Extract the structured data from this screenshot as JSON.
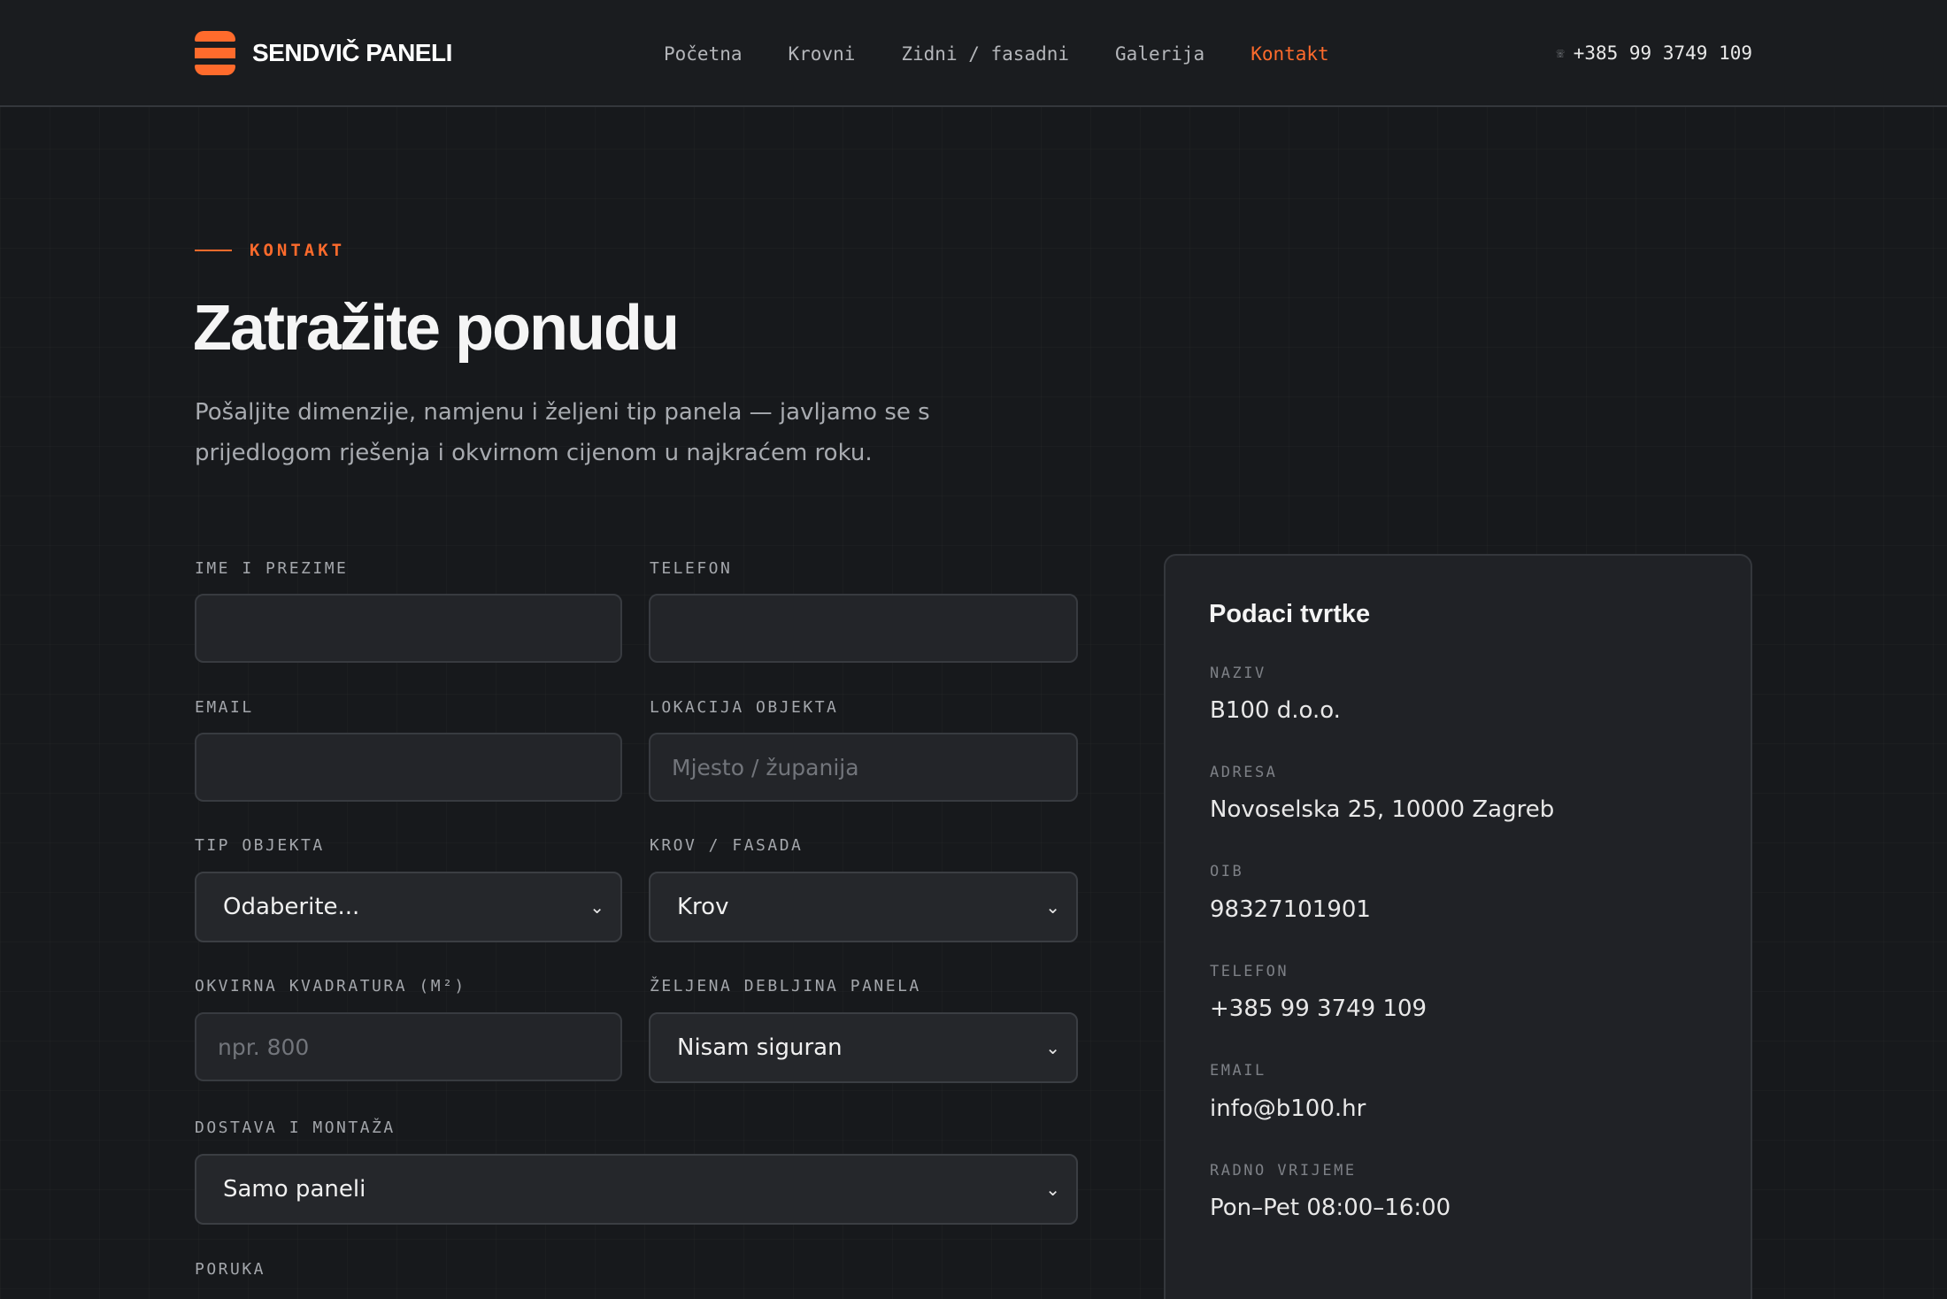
{
  "brand": {
    "name": "SENDVIČ PANELI",
    "accent": "#ff6b2c"
  },
  "nav": {
    "items": [
      {
        "label": "Početna",
        "active": false
      },
      {
        "label": "Krovni",
        "active": false
      },
      {
        "label": "Zidni / fasadni",
        "active": false
      },
      {
        "label": "Galerija",
        "active": false
      },
      {
        "label": "Kontakt",
        "active": true
      }
    ],
    "phone": "+385 99 3749 109",
    "phone_icon": "phone-icon"
  },
  "hero": {
    "eyebrow": "KONTAKT",
    "title": "Zatražite ponudu",
    "lead": "Pošaljite dimenzije, namjenu i željeni tip panela — javljamo se s prijedlogom rješenja i okvirnom cijenom u najkraćem roku."
  },
  "form": {
    "name_label": "IME I PREZIME",
    "name_value": "",
    "phone_label": "TELEFON",
    "phone_value": "",
    "email_label": "EMAIL",
    "email_value": "",
    "location_label": "LOKACIJA OBJEKTA",
    "location_placeholder": "Mjesto / županija",
    "object_type_label": "TIP OBJEKTA",
    "object_type_value": "Odaberite...",
    "roof_facade_label": "KROV / FASADA",
    "roof_facade_value": "Krov",
    "area_label": "OKVIRNA KVADRATURA (M²)",
    "area_placeholder": "npr. 800",
    "thickness_label": "ŽELJENA DEBLJINA PANELA",
    "thickness_value": "Nisam siguran",
    "delivery_label": "DOSTAVA I MONTAŽA",
    "delivery_value": "Samo paneli",
    "message_label": "PORUKA"
  },
  "company": {
    "title": "Podaci tvrtke",
    "name_label": "NAZIV",
    "name_value": "B100 d.o.o.",
    "address_label": "ADRESA",
    "address_value": "Novoselska 25, 10000 Zagreb",
    "oib_label": "OIB",
    "oib_value": "98327101901",
    "phone_label": "TELEFON",
    "phone_value": "+385 99 3749 109",
    "email_label": "EMAIL",
    "email_value": "info@b100.hr",
    "hours_label": "RADNO VRIJEME",
    "hours_value": "Pon–Pet 08:00–16:00"
  }
}
